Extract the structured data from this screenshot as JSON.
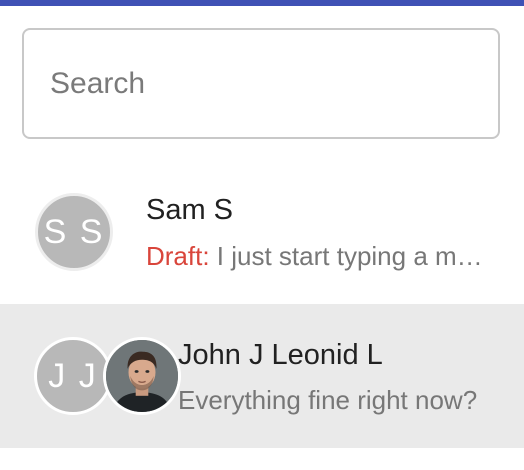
{
  "colors": {
    "accent_bar": "#3f51b5",
    "draft_label": "#d9453b",
    "avatar_placeholder": "#b8b8b8",
    "selected_row_bg": "#eaeaea"
  },
  "search": {
    "placeholder": "Search",
    "value": ""
  },
  "conversations": [
    {
      "avatar_initials": "S S",
      "name": "Sam S",
      "draft_label": "Draft:",
      "preview": " I just start typing a message and a draft is created"
    },
    {
      "avatar_initials": "J J",
      "avatar_image": "user-photo",
      "name": "John J Leonid L",
      "preview": "Everything fine right now?",
      "selected": true
    }
  ]
}
